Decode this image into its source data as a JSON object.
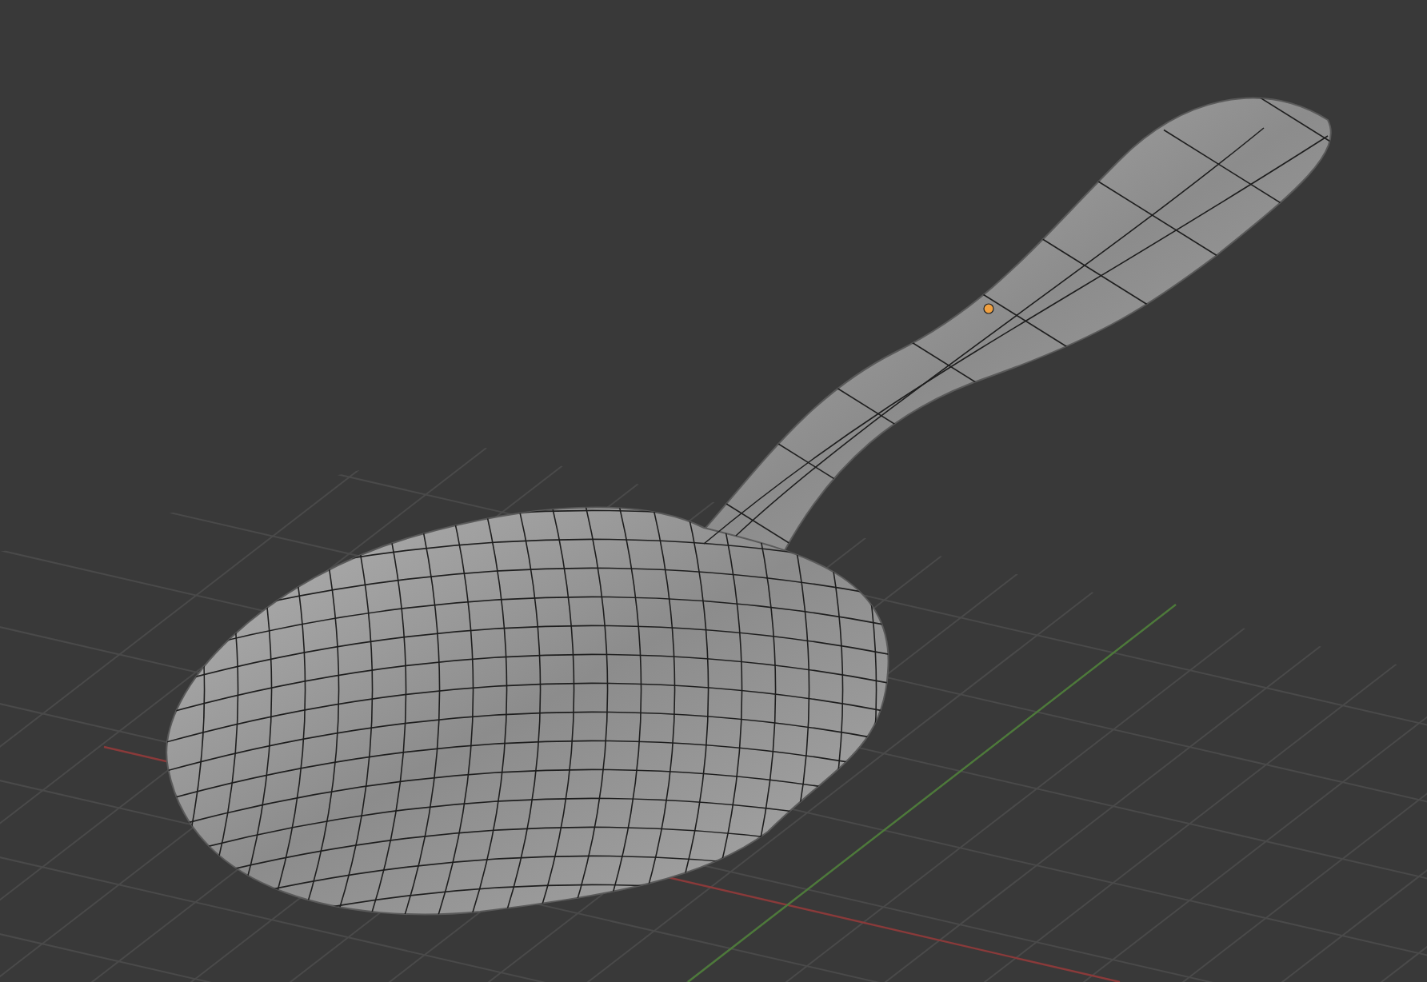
{
  "viewport": {
    "kind": "perspective",
    "grid": true,
    "axes": [
      {
        "kind": "x"
      },
      {
        "kind": "y"
      }
    ],
    "object": {
      "kind": "spoon",
      "wireframe": true,
      "origin_marker": true
    }
  }
}
